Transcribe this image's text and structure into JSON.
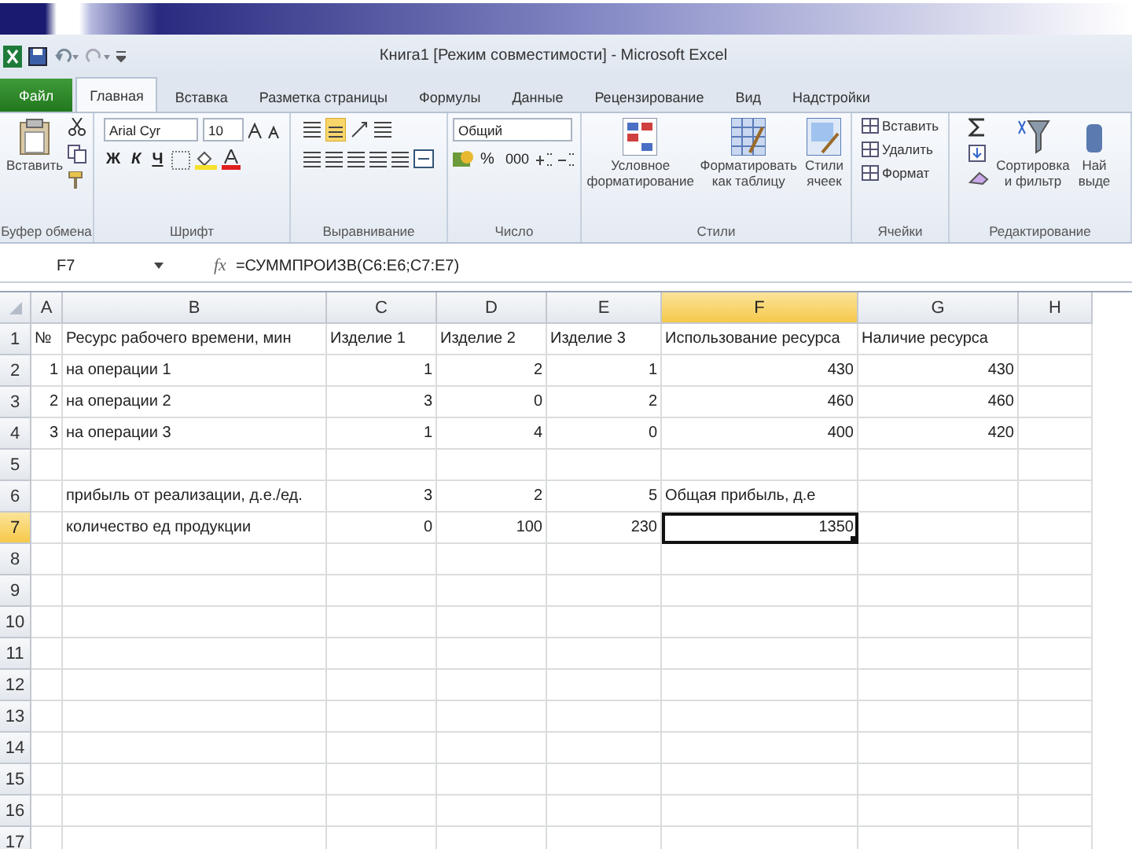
{
  "window": {
    "title": "Книга1  [Режим совместимости] - Microsoft Excel"
  },
  "tabs": [
    {
      "label": "Файл",
      "kind": "file",
      "selected": false
    },
    {
      "label": "Главная",
      "kind": "tab",
      "selected": true
    },
    {
      "label": "Вставка",
      "kind": "tab",
      "selected": false
    },
    {
      "label": "Разметка страницы",
      "kind": "tab",
      "selected": false
    },
    {
      "label": "Формулы",
      "kind": "tab",
      "selected": false
    },
    {
      "label": "Данные",
      "kind": "tab",
      "selected": false
    },
    {
      "label": "Рецензирование",
      "kind": "tab",
      "selected": false
    },
    {
      "label": "Вид",
      "kind": "tab",
      "selected": false
    },
    {
      "label": "Надстройки",
      "kind": "tab",
      "selected": false
    }
  ],
  "ribbon": {
    "groups": [
      {
        "kind": "clipboard",
        "label": "Буфер обмена",
        "paste": "Вставить"
      },
      {
        "kind": "font",
        "label": "Шрифт",
        "font": "Arial Cyr",
        "size": "10",
        "bold": "Ж",
        "italic": "К",
        "underline": "Ч"
      },
      {
        "kind": "alignment",
        "label": "Выравнивание"
      },
      {
        "kind": "number",
        "label": "Число",
        "format": "Общий",
        "percent": "%",
        "thousands": "000"
      },
      {
        "kind": "styles",
        "label": "Стили",
        "buttons": [
          "Условное форматирование",
          "Форматировать как таблицу",
          "Стили ячеек"
        ]
      },
      {
        "kind": "cells",
        "label": "Ячейки",
        "buttons": [
          "Вставить",
          "Удалить",
          "Формат"
        ]
      },
      {
        "kind": "editing",
        "label": "Редактирование",
        "sort": "Сортировка и фильтр",
        "find": "Най выде"
      }
    ]
  },
  "formula_bar": {
    "name_box": "F7",
    "fx": "fx",
    "formula": "=СУММПРОИЗВ(C6:E6;C7:E7)"
  },
  "grid": {
    "columns": [
      {
        "label": "A",
        "selected": false
      },
      {
        "label": "B",
        "selected": false
      },
      {
        "label": "C",
        "selected": false
      },
      {
        "label": "D",
        "selected": false
      },
      {
        "label": "E",
        "selected": false
      },
      {
        "label": "F",
        "selected": true
      },
      {
        "label": "G",
        "selected": false
      },
      {
        "label": "H",
        "selected": false
      }
    ],
    "rows": [
      {
        "label": "1",
        "selected": false,
        "cells": [
          {
            "text": "№",
            "kind": "text"
          },
          {
            "text": "Ресурс рабочего времени, мин",
            "kind": "text"
          },
          {
            "text": "Изделие 1",
            "kind": "text"
          },
          {
            "text": "Изделие 2",
            "kind": "text"
          },
          {
            "text": "Изделие 3",
            "kind": "text"
          },
          {
            "text": "Использование ресурса",
            "kind": "text"
          },
          {
            "text": "Наличие ресурса",
            "kind": "text"
          },
          null
        ]
      },
      {
        "label": "2",
        "selected": false,
        "cells": [
          {
            "text": "1",
            "kind": "number"
          },
          {
            "text": "на операции 1",
            "kind": "text"
          },
          {
            "text": "1",
            "kind": "number"
          },
          {
            "text": "2",
            "kind": "number"
          },
          {
            "text": "1",
            "kind": "number"
          },
          {
            "text": "430",
            "kind": "number"
          },
          {
            "text": "430",
            "kind": "number"
          },
          null
        ]
      },
      {
        "label": "3",
        "selected": false,
        "cells": [
          {
            "text": "2",
            "kind": "number"
          },
          {
            "text": "на операции 2",
            "kind": "text"
          },
          {
            "text": "3",
            "kind": "number"
          },
          {
            "text": "0",
            "kind": "number"
          },
          {
            "text": "2",
            "kind": "number"
          },
          {
            "text": "460",
            "kind": "number"
          },
          {
            "text": "460",
            "kind": "number"
          },
          null
        ]
      },
      {
        "label": "4",
        "selected": false,
        "cells": [
          {
            "text": "3",
            "kind": "number"
          },
          {
            "text": "на операции 3",
            "kind": "text"
          },
          {
            "text": "1",
            "kind": "number"
          },
          {
            "text": "4",
            "kind": "number"
          },
          {
            "text": "0",
            "kind": "number"
          },
          {
            "text": "400",
            "kind": "number"
          },
          {
            "text": "420",
            "kind": "number"
          },
          null
        ]
      },
      {
        "label": "5",
        "selected": false,
        "cells": [
          null,
          null,
          null,
          null,
          null,
          null,
          null,
          null
        ]
      },
      {
        "label": "6",
        "selected": false,
        "cells": [
          null,
          {
            "text": "прибыль от реализации, д.е./ед.",
            "kind": "text"
          },
          {
            "text": "3",
            "kind": "number"
          },
          {
            "text": "2",
            "kind": "number"
          },
          {
            "text": "5",
            "kind": "number"
          },
          {
            "text": "Общая прибыль, д.е",
            "kind": "text"
          },
          null,
          null
        ]
      },
      {
        "label": "7",
        "selected": true,
        "cells": [
          null,
          {
            "text": "количество ед продукции",
            "kind": "text"
          },
          {
            "text": "0",
            "kind": "number"
          },
          {
            "text": "100",
            "kind": "number"
          },
          {
            "text": "230",
            "kind": "number"
          },
          {
            "text": "1350",
            "kind": "number"
          },
          null,
          null
        ]
      },
      {
        "label": "8",
        "selected": false,
        "cells": [
          null,
          null,
          null,
          null,
          null,
          null,
          null,
          null
        ]
      },
      {
        "label": "9",
        "selected": false,
        "cells": [
          null,
          null,
          null,
          null,
          null,
          null,
          null,
          null
        ]
      },
      {
        "label": "10",
        "selected": false,
        "cells": [
          null,
          null,
          null,
          null,
          null,
          null,
          null,
          null
        ]
      },
      {
        "label": "11",
        "selected": false,
        "cells": [
          null,
          null,
          null,
          null,
          null,
          null,
          null,
          null
        ]
      },
      {
        "label": "12",
        "selected": false,
        "cells": [
          null,
          null,
          null,
          null,
          null,
          null,
          null,
          null
        ]
      },
      {
        "label": "13",
        "selected": false,
        "cells": [
          null,
          null,
          null,
          null,
          null,
          null,
          null,
          null
        ]
      },
      {
        "label": "14",
        "selected": false,
        "cells": [
          null,
          null,
          null,
          null,
          null,
          null,
          null,
          null
        ]
      },
      {
        "label": "15",
        "selected": false,
        "cells": [
          null,
          null,
          null,
          null,
          null,
          null,
          null,
          null
        ]
      },
      {
        "label": "16",
        "selected": false,
        "cells": [
          null,
          null,
          null,
          null,
          null,
          null,
          null,
          null
        ]
      },
      {
        "label": "17",
        "selected": false,
        "cells": [
          null,
          null,
          null,
          null,
          null,
          null,
          null,
          null
        ]
      }
    ]
  }
}
